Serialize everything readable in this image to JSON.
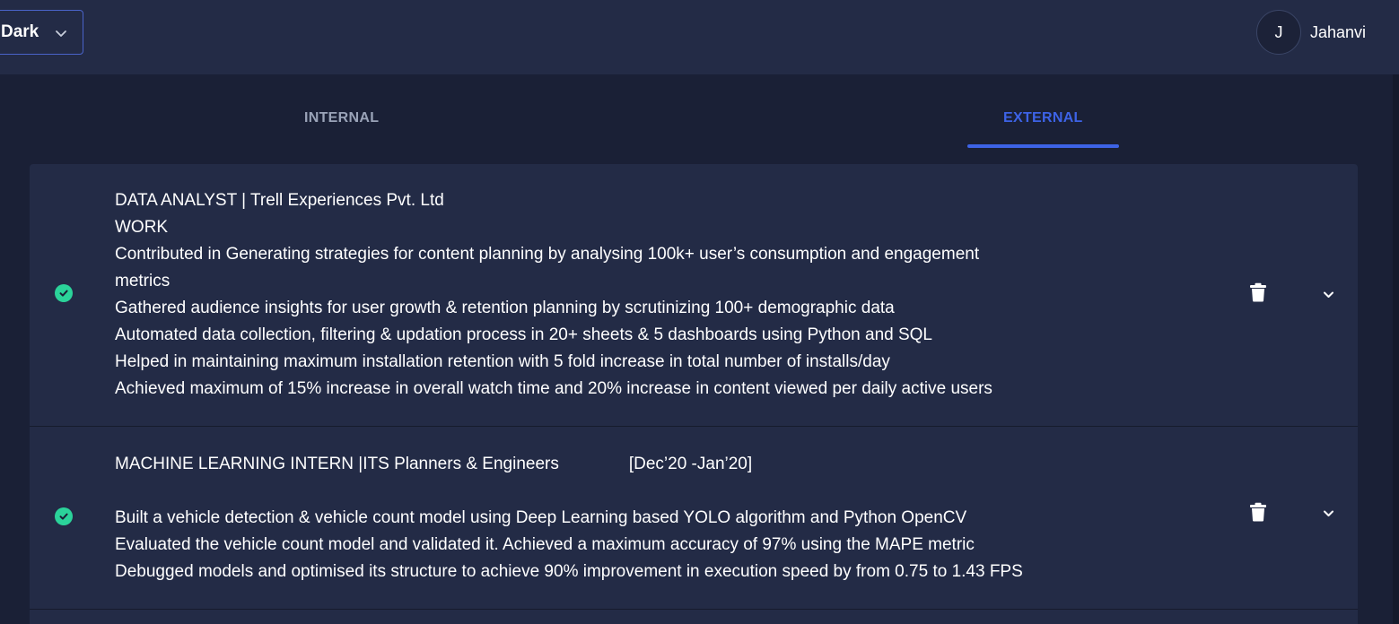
{
  "header": {
    "theme_select": {
      "value": "Dark"
    },
    "user": {
      "avatar_initial": "J",
      "name": "Jahanvi"
    }
  },
  "tabs": [
    {
      "label": "INTERNAL",
      "active": false
    },
    {
      "label": "EXTERNAL",
      "active": true
    }
  ],
  "colors": {
    "accent": "#3d63e6",
    "success": "#2bd39a",
    "background": "#1a2036",
    "card": "#232b46"
  },
  "experiences": [
    {
      "status_icon": "check-circle-icon",
      "title": "DATA ANALYST | Trell Experiences Pvt. Ltd",
      "lines": [
        "WORK",
        " Contributed in Generating strategies for content planning by analysing 100k+ user’s consumption and engagement",
        "metrics",
        " Gathered audience insights for user growth & retention planning by scrutinizing 100+ demographic data",
        " Automated data collection, filtering & updation process in 20+ sheets & 5 dashboards using Python and SQL",
        " Helped in maintaining maximum installation retention with 5 fold increase in total number of installs/day",
        " Achieved maximum of 15% increase in overall watch time and 20% increase in content viewed per daily active users"
      ]
    },
    {
      "status_icon": "check-circle-icon",
      "title": "MACHINE LEARNING INTERN |ITS Planners & Engineers",
      "date": "[Dec’20 -Jan’20]",
      "lines": [
        "Built a vehicle detection & vehicle count model using Deep Learning based YOLO algorithm and Python OpenCV",
        "Evaluated the vehicle count model and validated it.  Achieved a maximum accuracy of 97% using the MAPE metric",
        "Debugged models and optimised its structure to achieve 90% improvement in execution speed by from 0.75 to 1.43 FPS"
      ]
    }
  ]
}
